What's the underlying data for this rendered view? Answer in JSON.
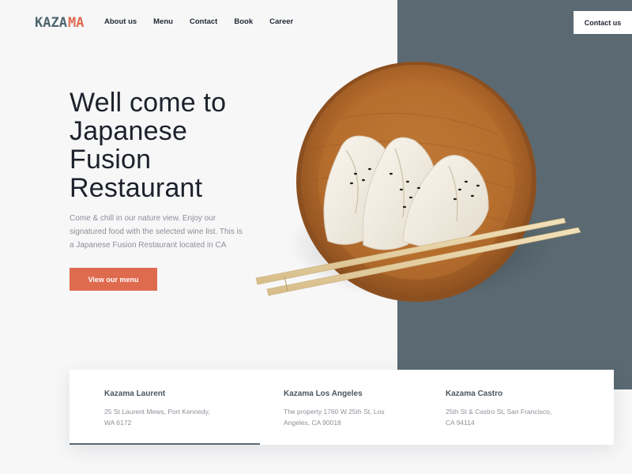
{
  "brand": {
    "logo_part1": "KAZA",
    "logo_part2": "MA",
    "colors": {
      "accent": "#df6b4f",
      "slate": "#5b6a72",
      "dark": "#1d212b"
    }
  },
  "nav": {
    "items": [
      {
        "label": "About us"
      },
      {
        "label": "Menu"
      },
      {
        "label": "Contact"
      },
      {
        "label": "Book"
      },
      {
        "label": "Career"
      }
    ],
    "contact_button": "Contact us"
  },
  "hero": {
    "title_lines": [
      "Well come to",
      "Japanese",
      "Fusion",
      "Restaurant"
    ],
    "description_lines": [
      "Come & chill in our nature view. Enjoy our",
      "signatured food with the selected wine list. This is",
      "a Japanese Fusion Restaurant located in CA"
    ],
    "cta_label": "View our menu"
  },
  "locations": [
    {
      "name": "Kazama Laurent",
      "address_lines": [
        "25 St Laurent Mews, Port Kennedy,",
        "WA 6172"
      ],
      "active": true
    },
    {
      "name": "Kazama Los Angeles",
      "address_lines": [
        "The property 1760 W 25th St, Los",
        "Angeles, CA 90018"
      ],
      "active": false
    },
    {
      "name": "Kazama Castro",
      "address_lines": [
        "25th St & Castro St, San Francisco,",
        "CA 94114"
      ],
      "active": false
    }
  ]
}
